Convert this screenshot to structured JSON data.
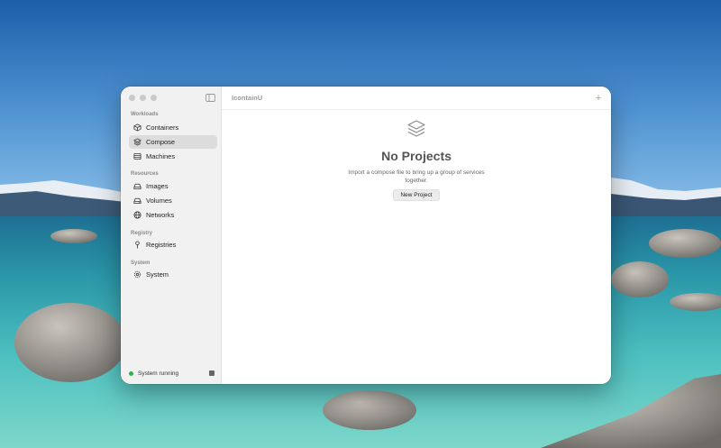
{
  "app": {
    "title": "IcontainU"
  },
  "sidebar": {
    "sections": [
      {
        "header": "Workloads",
        "items": [
          {
            "label": "Containers",
            "icon": "cube-icon"
          },
          {
            "label": "Compose",
            "icon": "stack-icon",
            "active": true
          },
          {
            "label": "Machines",
            "icon": "server-icon"
          }
        ]
      },
      {
        "header": "Resources",
        "items": [
          {
            "label": "Images",
            "icon": "drive-icon"
          },
          {
            "label": "Volumes",
            "icon": "volume-icon"
          },
          {
            "label": "Networks",
            "icon": "globe-icon"
          }
        ]
      },
      {
        "header": "Registry",
        "items": [
          {
            "label": "Registries",
            "icon": "pin-icon"
          }
        ]
      },
      {
        "header": "System",
        "items": [
          {
            "label": "System",
            "icon": "gear-icon"
          }
        ]
      }
    ],
    "status": {
      "label": "System running",
      "color": "#2fb34a"
    }
  },
  "main": {
    "empty_state": {
      "title": "No Projects",
      "description": "Import a compose file to bring up a group of services together.",
      "button": "New Project"
    }
  }
}
